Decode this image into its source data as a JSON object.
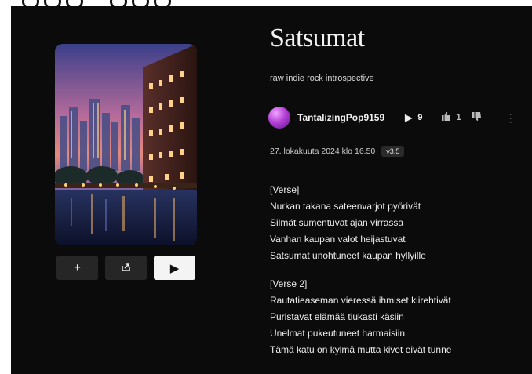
{
  "song": {
    "title": "Satsumat",
    "style": "raw indie rock introspective",
    "artist": "TantalizingPop9159",
    "plays": "9",
    "likes": "1",
    "date": "27. lokakuuta 2024 klo 16.50",
    "version": "v3.5"
  },
  "icons": {
    "add": "plus-icon",
    "share": "share-icon",
    "play": "play-icon",
    "plays": "play-count-icon",
    "like": "thumbs-up-icon",
    "dislike": "thumbs-down-icon",
    "more": "more-vertical-icon"
  },
  "lyrics": {
    "verse1_label": "[Verse]",
    "verse1": [
      "Nurkan takana sateenvarjot pyörivät",
      "Silmät sumentuvat ajan virrassa",
      "Vanhan kaupan valot heijastuvat",
      "Satsumat unohtuneet kaupan hyllyille"
    ],
    "verse2_label": "[Verse 2]",
    "verse2": [
      "Rautatieaseman vieressä ihmiset kiirehtivät",
      "Puristavat elämää tiukasti käsiin",
      "Unelmat pukeutuneet harmaisiin",
      "Tämä katu on kylmä mutta kivet eivät tunne"
    ]
  },
  "colors": {
    "background": "#0b0b0b",
    "text": "#ededed",
    "button": "#262626",
    "primary_button": "#f4f4f4"
  }
}
